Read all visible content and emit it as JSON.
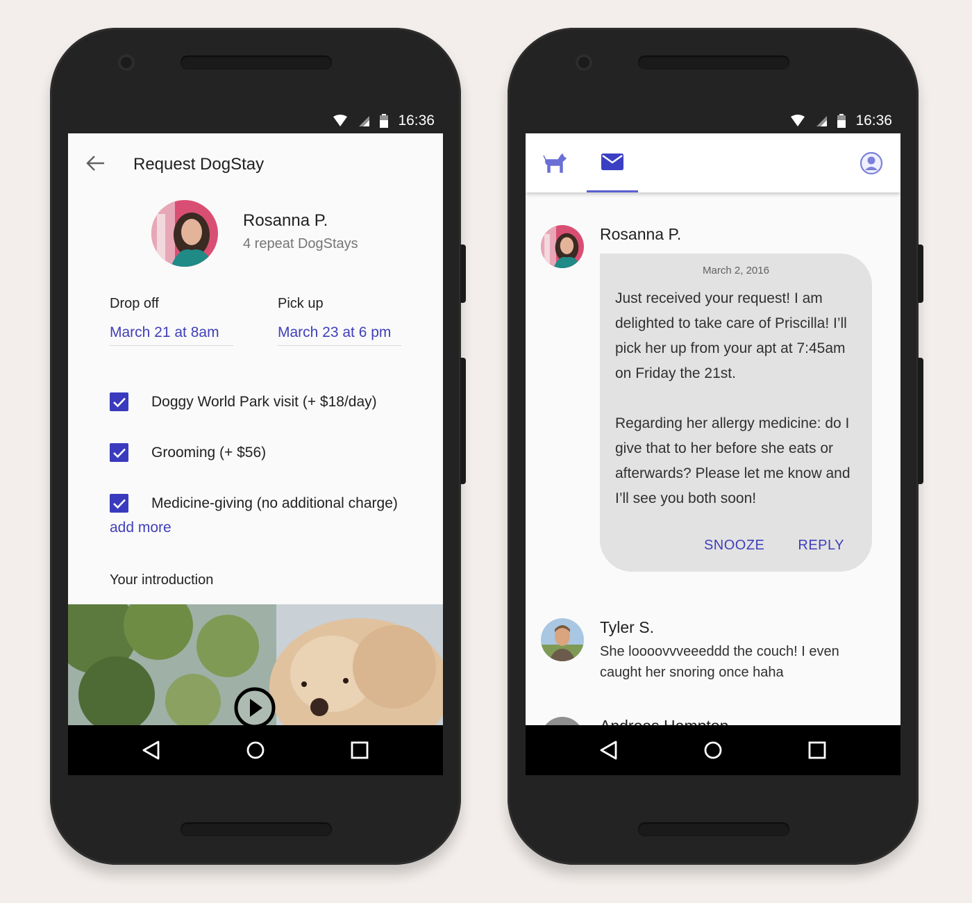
{
  "status_bar": {
    "time": "16:36"
  },
  "request_screen": {
    "title": "Request DogStay",
    "sitter": {
      "name": "Rosanna P.",
      "subtitle": "4 repeat DogStays"
    },
    "drop_off": {
      "label": "Drop off",
      "value": "March 21 at 8am"
    },
    "pick_up": {
      "label": "Pick up",
      "value": "March 23 at 6 pm"
    },
    "options": [
      {
        "label": "Doggy World Park visit (+ $18/day)",
        "checked": true
      },
      {
        "label": "Grooming (+ $56)",
        "checked": true
      },
      {
        "label": "Medicine-giving (no additional charge)",
        "checked": true
      }
    ],
    "add_more": "add more",
    "intro_label": "Your introduction"
  },
  "messages_screen": {
    "tabs": [
      {
        "icon": "dog-icon"
      },
      {
        "icon": "mail-icon",
        "active": true
      },
      {
        "icon": "profile-icon"
      }
    ],
    "messages": [
      {
        "name": "Rosanna P.",
        "date": "March 2, 2016",
        "text": "Just received your request! I am delighted to take care of Priscilla! I’ll pick her up from your apt at 7:45am on Friday the 21st.\n\nRegarding her allergy medicine: do I give that to her before she eats or afterwards? Please let me know and I’ll see you both soon!",
        "actions": {
          "snooze": "SNOOZE",
          "reply": "REPLY"
        }
      },
      {
        "name": "Tyler S.",
        "preview": "She loooovvveeeddd the couch! I even caught her snoring once haha"
      },
      {
        "name": "Andreas Hampton"
      }
    ]
  },
  "colors": {
    "accent": "#3f3fba",
    "bubble": "#e2e2e2",
    "phone_body": "#232323",
    "background": "#f3eeeb"
  }
}
